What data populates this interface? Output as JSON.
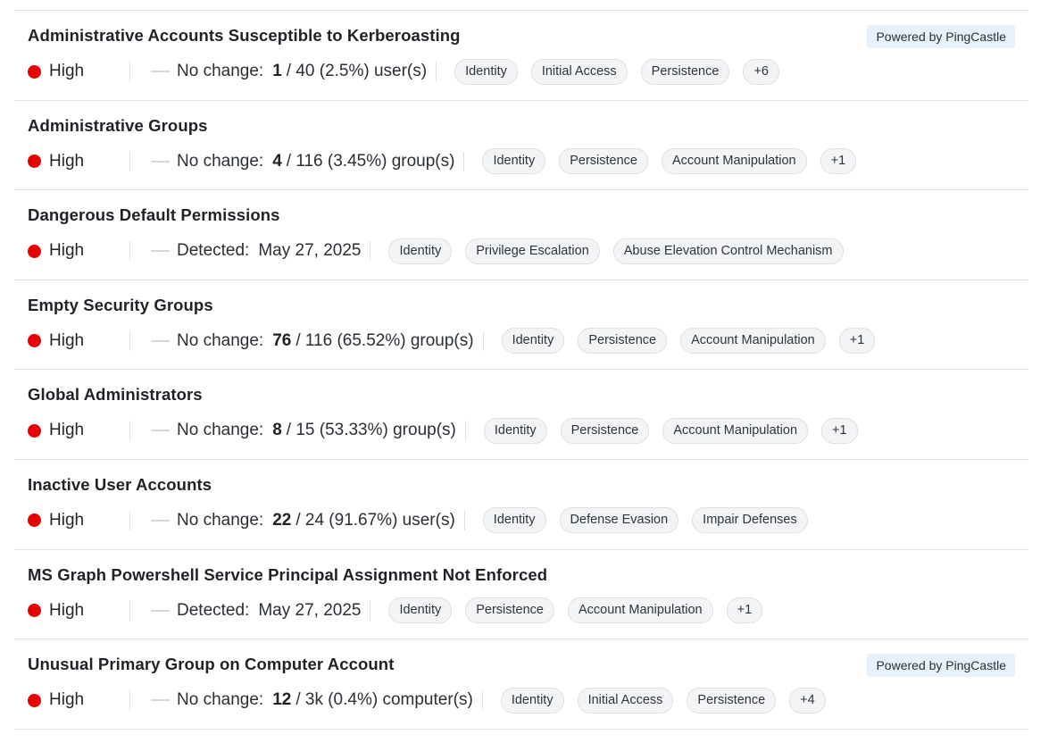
{
  "items": [
    {
      "title": "Administrative Accounts Susceptible to Kerberoasting",
      "powered_by": "Powered by PingCastle",
      "severity": "High",
      "change_label": "No change:",
      "count": "1",
      "detail": "/ 40 (2.5%) user(s)",
      "tags": [
        "Identity",
        "Initial Access",
        "Persistence",
        "+6"
      ]
    },
    {
      "title": "Administrative Groups",
      "powered_by": "",
      "severity": "High",
      "change_label": "No change:",
      "count": "4",
      "detail": "/ 116 (3.45%) group(s)",
      "tags": [
        "Identity",
        "Persistence",
        "Account Manipulation",
        "+1"
      ]
    },
    {
      "title": "Dangerous Default Permissions",
      "powered_by": "",
      "severity": "High",
      "change_label": "Detected:",
      "count": "",
      "detail": "May 27, 2025",
      "tags": [
        "Identity",
        "Privilege Escalation",
        "Abuse Elevation Control Mechanism"
      ]
    },
    {
      "title": "Empty Security Groups",
      "powered_by": "",
      "severity": "High",
      "change_label": "No change:",
      "count": "76",
      "detail": "/ 116 (65.52%) group(s)",
      "tags": [
        "Identity",
        "Persistence",
        "Account Manipulation",
        "+1"
      ]
    },
    {
      "title": "Global Administrators",
      "powered_by": "",
      "severity": "High",
      "change_label": "No change:",
      "count": "8",
      "detail": "/ 15 (53.33%) group(s)",
      "tags": [
        "Identity",
        "Persistence",
        "Account Manipulation",
        "+1"
      ]
    },
    {
      "title": "Inactive User Accounts",
      "powered_by": "",
      "severity": "High",
      "change_label": "No change:",
      "count": "22",
      "detail": "/ 24 (91.67%) user(s)",
      "tags": [
        "Identity",
        "Defense Evasion",
        "Impair Defenses"
      ]
    },
    {
      "title": "MS Graph Powershell Service Principal Assignment Not Enforced",
      "powered_by": "",
      "severity": "High",
      "change_label": "Detected:",
      "count": "",
      "detail": "May 27, 2025",
      "tags": [
        "Identity",
        "Persistence",
        "Account Manipulation",
        "+1"
      ]
    },
    {
      "title": "Unusual Primary Group on Computer Account",
      "powered_by": "Powered by PingCastle",
      "severity": "High",
      "change_label": "No change:",
      "count": "12",
      "detail": "/ 3k (0.4%) computer(s)",
      "tags": [
        "Identity",
        "Initial Access",
        "Persistence",
        "+4"
      ]
    }
  ],
  "colors": {
    "severity_high": "#e60000",
    "powered_bg": "#e6f1fb",
    "divider": "#dcdfe3"
  }
}
